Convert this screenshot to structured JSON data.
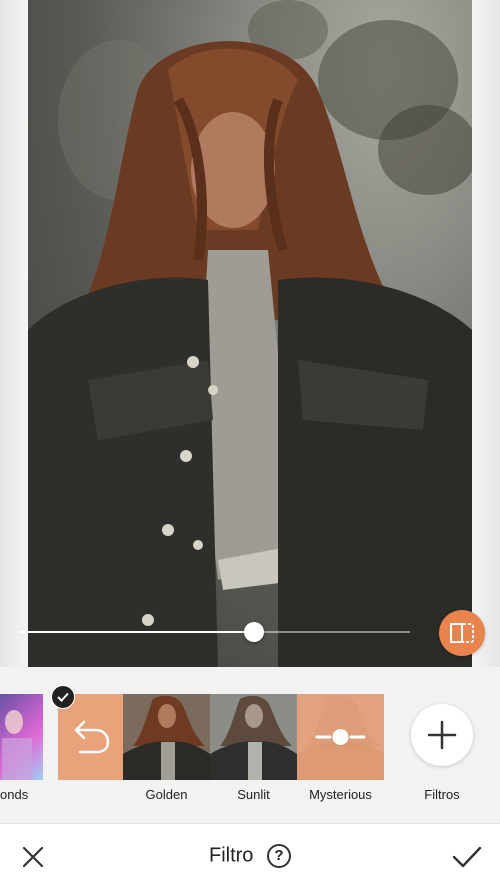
{
  "editor": {
    "title": "Filtro",
    "help_symbol": "?",
    "intensity": 0.6
  },
  "filters": [
    {
      "label": "onds",
      "selected": false
    },
    {
      "label": "",
      "selected": true,
      "kind": "undo"
    },
    {
      "label": "Golden",
      "selected": false
    },
    {
      "label": "Sunlit",
      "selected": false
    },
    {
      "label": "Mysterious",
      "selected": false
    },
    {
      "label": "Filtros",
      "selected": false,
      "kind": "add"
    }
  ],
  "colors": {
    "accent": "#e9844e",
    "tile_orange": "#eaa27b",
    "bar_bg": "#ffffff"
  },
  "icons": [
    "compare-icon",
    "check-icon",
    "undo-icon",
    "slider-icon",
    "plus-icon",
    "close-icon",
    "help-icon",
    "confirm-check-icon"
  ]
}
